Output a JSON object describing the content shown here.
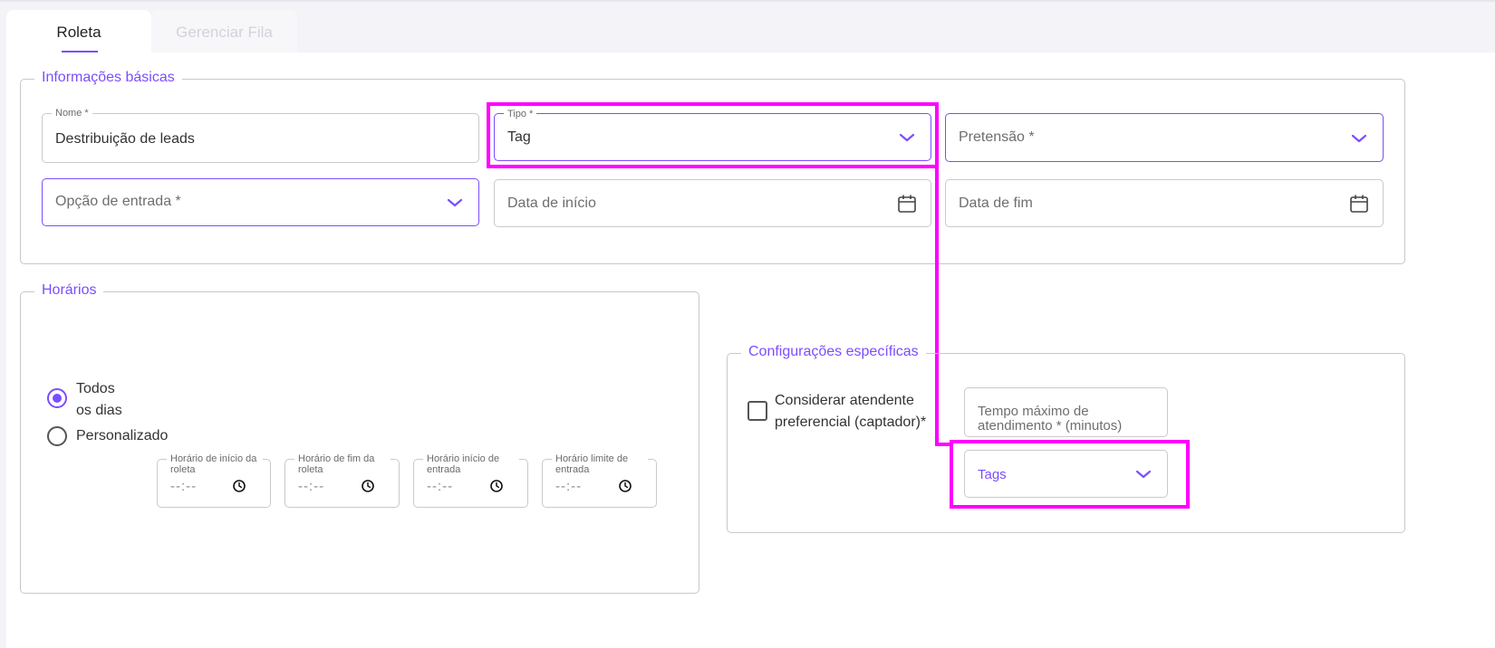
{
  "tabs": [
    {
      "label": "Roleta",
      "active": true
    },
    {
      "label": "Gerenciar Fila",
      "active": false
    }
  ],
  "basic_info": {
    "legend": "Informações básicas",
    "nome": {
      "label": "Nome *",
      "value": "Destribuição de leads"
    },
    "tipo": {
      "label": "Tipo *",
      "value": "Tag",
      "icon": "chevron-down-icon"
    },
    "pretensao": {
      "placeholder": "Pretensão *",
      "icon": "chevron-down-icon"
    },
    "opcao_entrada": {
      "placeholder": "Opção de entrada *",
      "icon": "chevron-down-icon"
    },
    "data_inicio": {
      "placeholder": "Data de início",
      "icon": "calendar-icon"
    },
    "data_fim": {
      "placeholder": "Data de fim",
      "icon": "calendar-icon"
    }
  },
  "horarios": {
    "legend": "Horários",
    "radio_todos": {
      "label_line1": "Todos",
      "label_line2": "os dias",
      "checked": true
    },
    "radio_personalizado": {
      "label": "Personalizado",
      "checked": false
    },
    "time_fields": [
      {
        "label": "Horário de início da roleta",
        "value": "--:--"
      },
      {
        "label": "Horário de fim da roleta",
        "value": "--:--"
      },
      {
        "label": "Horário início de entrada",
        "value": "--:--"
      },
      {
        "label": "Horário limite de entrada",
        "value": "--:--"
      }
    ]
  },
  "config": {
    "legend": "Configurações específicas",
    "checkbox_label_line1": "Considerar atendente",
    "checkbox_label_line2": "preferencial (captador)*",
    "checkbox_checked": false,
    "tempo_line1": "Tempo máximo de",
    "tempo_line2": "atendimento * (minutos)",
    "tags": {
      "placeholder": "Tags",
      "icon": "chevron-down-icon"
    }
  },
  "colors": {
    "accent": "#7c4dff",
    "highlight": "#ff00ff",
    "border": "#c9c9cf",
    "background": "#f3f3f8"
  }
}
